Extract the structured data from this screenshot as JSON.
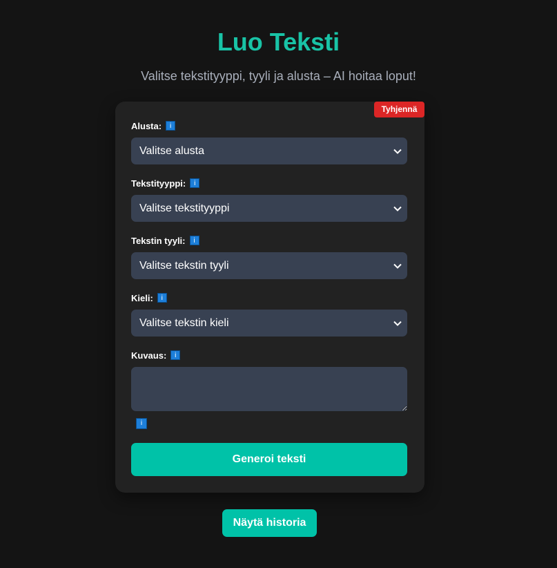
{
  "header": {
    "title": "Luo Teksti",
    "subtitle": "Valitse tekstityyppi, tyyli ja alusta – AI hoitaa loput!"
  },
  "form": {
    "clear_label": "Tyhjennä",
    "info_glyph": "i",
    "fields": [
      {
        "label": "Alusta:",
        "selected": "Valitse alusta"
      },
      {
        "label": "Tekstityyppi:",
        "selected": "Valitse tekstityyppi"
      },
      {
        "label": "Tekstin tyyli:",
        "selected": "Valitse tekstin tyyli"
      },
      {
        "label": "Kieli:",
        "selected": "Valitse tekstin kieli"
      }
    ],
    "description": {
      "label": "Kuvaus:",
      "value": ""
    },
    "generate_label": "Generoi teksti"
  },
  "footer": {
    "history_label": "Näytä historia"
  },
  "colors": {
    "background": "#141414",
    "accent": "#00c2a8",
    "title": "#19c3a6",
    "card": "#222222",
    "input": "#384152",
    "danger": "#dc2626",
    "info": "#1d7fd9"
  },
  "icons": {
    "info": "info-icon",
    "dropdown": "chevron-down-icon"
  }
}
